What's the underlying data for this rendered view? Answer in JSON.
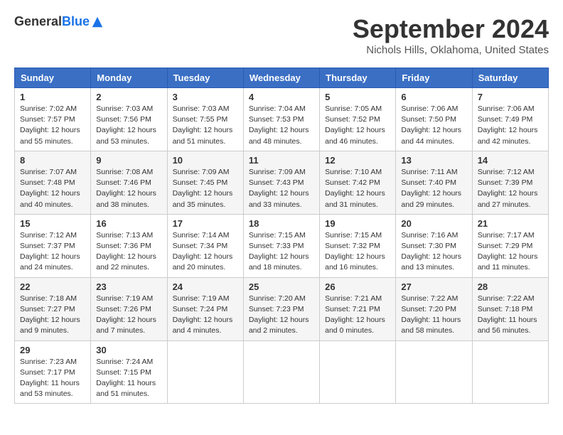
{
  "header": {
    "logo_general": "General",
    "logo_blue": "Blue",
    "month_title": "September 2024",
    "location": "Nichols Hills, Oklahoma, United States"
  },
  "calendar": {
    "headers": [
      "Sunday",
      "Monday",
      "Tuesday",
      "Wednesday",
      "Thursday",
      "Friday",
      "Saturday"
    ],
    "weeks": [
      [
        {
          "day": "1",
          "info": "Sunrise: 7:02 AM\nSunset: 7:57 PM\nDaylight: 12 hours\nand 55 minutes."
        },
        {
          "day": "2",
          "info": "Sunrise: 7:03 AM\nSunset: 7:56 PM\nDaylight: 12 hours\nand 53 minutes."
        },
        {
          "day": "3",
          "info": "Sunrise: 7:03 AM\nSunset: 7:55 PM\nDaylight: 12 hours\nand 51 minutes."
        },
        {
          "day": "4",
          "info": "Sunrise: 7:04 AM\nSunset: 7:53 PM\nDaylight: 12 hours\nand 48 minutes."
        },
        {
          "day": "5",
          "info": "Sunrise: 7:05 AM\nSunset: 7:52 PM\nDaylight: 12 hours\nand 46 minutes."
        },
        {
          "day": "6",
          "info": "Sunrise: 7:06 AM\nSunset: 7:50 PM\nDaylight: 12 hours\nand 44 minutes."
        },
        {
          "day": "7",
          "info": "Sunrise: 7:06 AM\nSunset: 7:49 PM\nDaylight: 12 hours\nand 42 minutes."
        }
      ],
      [
        {
          "day": "8",
          "info": "Sunrise: 7:07 AM\nSunset: 7:48 PM\nDaylight: 12 hours\nand 40 minutes."
        },
        {
          "day": "9",
          "info": "Sunrise: 7:08 AM\nSunset: 7:46 PM\nDaylight: 12 hours\nand 38 minutes."
        },
        {
          "day": "10",
          "info": "Sunrise: 7:09 AM\nSunset: 7:45 PM\nDaylight: 12 hours\nand 35 minutes."
        },
        {
          "day": "11",
          "info": "Sunrise: 7:09 AM\nSunset: 7:43 PM\nDaylight: 12 hours\nand 33 minutes."
        },
        {
          "day": "12",
          "info": "Sunrise: 7:10 AM\nSunset: 7:42 PM\nDaylight: 12 hours\nand 31 minutes."
        },
        {
          "day": "13",
          "info": "Sunrise: 7:11 AM\nSunset: 7:40 PM\nDaylight: 12 hours\nand 29 minutes."
        },
        {
          "day": "14",
          "info": "Sunrise: 7:12 AM\nSunset: 7:39 PM\nDaylight: 12 hours\nand 27 minutes."
        }
      ],
      [
        {
          "day": "15",
          "info": "Sunrise: 7:12 AM\nSunset: 7:37 PM\nDaylight: 12 hours\nand 24 minutes."
        },
        {
          "day": "16",
          "info": "Sunrise: 7:13 AM\nSunset: 7:36 PM\nDaylight: 12 hours\nand 22 minutes."
        },
        {
          "day": "17",
          "info": "Sunrise: 7:14 AM\nSunset: 7:34 PM\nDaylight: 12 hours\nand 20 minutes."
        },
        {
          "day": "18",
          "info": "Sunrise: 7:15 AM\nSunset: 7:33 PM\nDaylight: 12 hours\nand 18 minutes."
        },
        {
          "day": "19",
          "info": "Sunrise: 7:15 AM\nSunset: 7:32 PM\nDaylight: 12 hours\nand 16 minutes."
        },
        {
          "day": "20",
          "info": "Sunrise: 7:16 AM\nSunset: 7:30 PM\nDaylight: 12 hours\nand 13 minutes."
        },
        {
          "day": "21",
          "info": "Sunrise: 7:17 AM\nSunset: 7:29 PM\nDaylight: 12 hours\nand 11 minutes."
        }
      ],
      [
        {
          "day": "22",
          "info": "Sunrise: 7:18 AM\nSunset: 7:27 PM\nDaylight: 12 hours\nand 9 minutes."
        },
        {
          "day": "23",
          "info": "Sunrise: 7:19 AM\nSunset: 7:26 PM\nDaylight: 12 hours\nand 7 minutes."
        },
        {
          "day": "24",
          "info": "Sunrise: 7:19 AM\nSunset: 7:24 PM\nDaylight: 12 hours\nand 4 minutes."
        },
        {
          "day": "25",
          "info": "Sunrise: 7:20 AM\nSunset: 7:23 PM\nDaylight: 12 hours\nand 2 minutes."
        },
        {
          "day": "26",
          "info": "Sunrise: 7:21 AM\nSunset: 7:21 PM\nDaylight: 12 hours\nand 0 minutes."
        },
        {
          "day": "27",
          "info": "Sunrise: 7:22 AM\nSunset: 7:20 PM\nDaylight: 11 hours\nand 58 minutes."
        },
        {
          "day": "28",
          "info": "Sunrise: 7:22 AM\nSunset: 7:18 PM\nDaylight: 11 hours\nand 56 minutes."
        }
      ],
      [
        {
          "day": "29",
          "info": "Sunrise: 7:23 AM\nSunset: 7:17 PM\nDaylight: 11 hours\nand 53 minutes."
        },
        {
          "day": "30",
          "info": "Sunrise: 7:24 AM\nSunset: 7:15 PM\nDaylight: 11 hours\nand 51 minutes."
        },
        {
          "day": "",
          "info": ""
        },
        {
          "day": "",
          "info": ""
        },
        {
          "day": "",
          "info": ""
        },
        {
          "day": "",
          "info": ""
        },
        {
          "day": "",
          "info": ""
        }
      ]
    ]
  }
}
